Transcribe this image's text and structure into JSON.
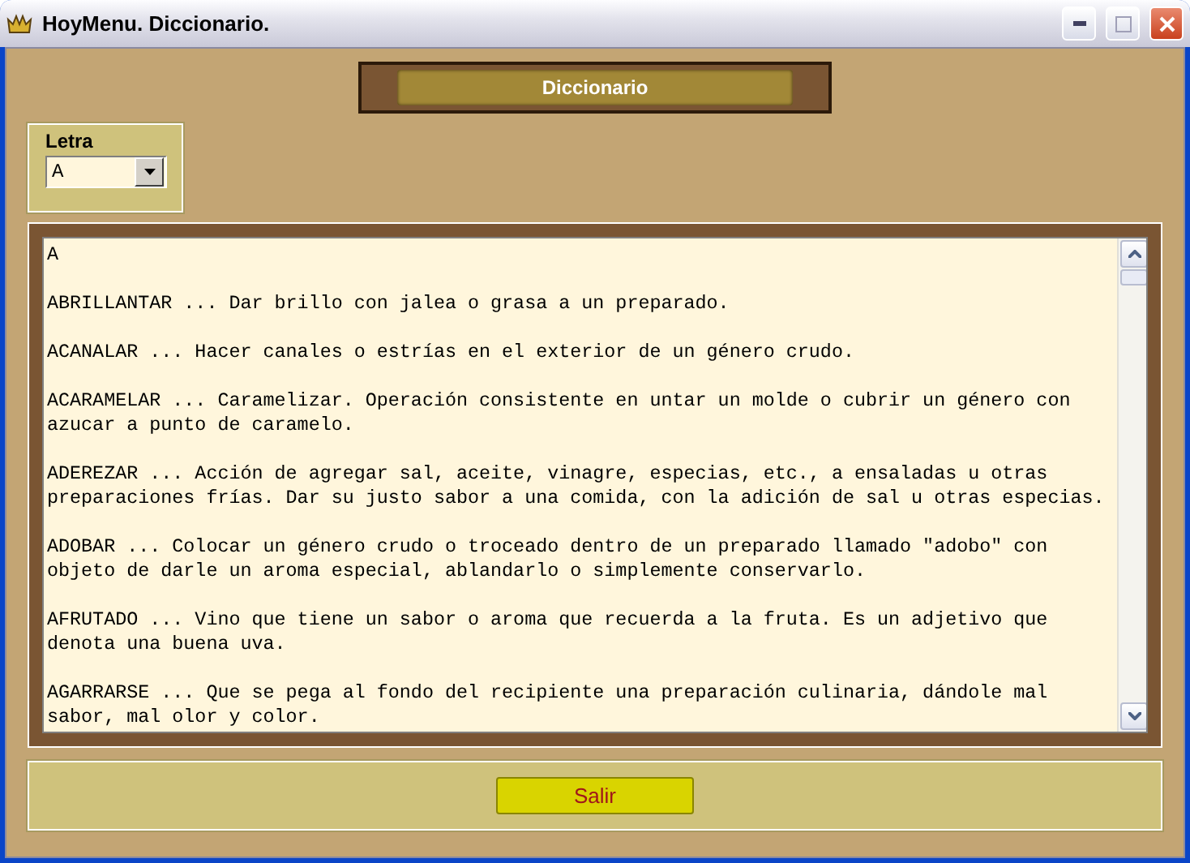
{
  "window": {
    "title": "HoyMenu. Diccionario."
  },
  "header": {
    "title": "Diccionario"
  },
  "letter_select": {
    "label": "Letra",
    "value": "A"
  },
  "dictionary": {
    "heading": "A",
    "entries": [
      "ABRILLANTAR ... Dar brillo con jalea o grasa a un preparado.",
      "ACANALAR ... Hacer canales o estrías en el exterior de un género crudo.",
      "ACARAMELAR ... Caramelizar. Operación consistente en untar un molde o cubrir un género con azucar a punto de caramelo.",
      "ADEREZAR ... Acción de agregar sal, aceite, vinagre, especias, etc., a ensaladas u otras preparaciones frías. Dar su justo sabor a una comida, con la adición de sal u otras especias.",
      "ADOBAR ... Colocar un género crudo o troceado dentro de un preparado llamado \"adobo\" con objeto de darle un aroma especial, ablandarlo o simplemente conservarlo.",
      "AFRUTADO ... Vino que tiene un sabor o aroma que recuerda a la fruta. Es un adjetivo que denota una buena uva.",
      "AGARRARSE ... Que se pega al fondo del recipiente una preparación culinaria, dándole mal sabor, mal olor y color."
    ]
  },
  "exit_button": {
    "label": "Salir"
  }
}
